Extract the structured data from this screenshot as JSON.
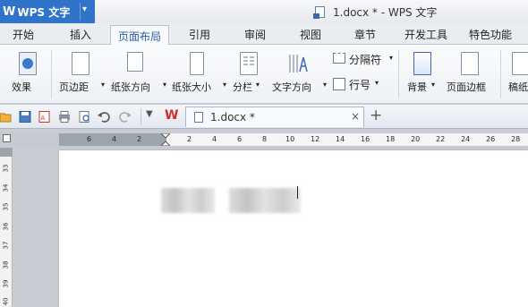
{
  "app": {
    "logo": "W",
    "name": "WPS 文字",
    "title": "1.docx * - WPS 文字"
  },
  "ribbon_tabs": [
    {
      "label": "开始",
      "active": false
    },
    {
      "label": "插入",
      "active": false
    },
    {
      "label": "页面布局",
      "active": true
    },
    {
      "label": "引用",
      "active": false
    },
    {
      "label": "审阅",
      "active": false
    },
    {
      "label": "视图",
      "active": false
    },
    {
      "label": "章节",
      "active": false
    },
    {
      "label": "开发工具",
      "active": false
    },
    {
      "label": "特色功能",
      "active": false
    }
  ],
  "ribbon": {
    "effects": "效果",
    "margins": "页边距",
    "orientation": "纸张方向",
    "size": "纸张大小",
    "columns": "分栏",
    "text_direction": "文字方向",
    "separator": "分隔符",
    "line_number": "行号",
    "background": "背景",
    "page_border": "页面边框",
    "cut_label": "稿纸"
  },
  "doc_tab": {
    "name": "1.docx *",
    "close": "×",
    "new": "+"
  },
  "ruler": {
    "h_ticks": [
      "6",
      "4",
      "2",
      "2",
      "4",
      "6",
      "8",
      "10",
      "12",
      "14",
      "16",
      "18",
      "20",
      "22",
      "24",
      "26",
      "28"
    ],
    "v_ticks": [
      "33",
      "34",
      "35",
      "36",
      "37",
      "38",
      "39",
      "40"
    ]
  },
  "colors": {
    "accent": "#2f74c8",
    "active_tab_text": "#2b5ea8"
  }
}
